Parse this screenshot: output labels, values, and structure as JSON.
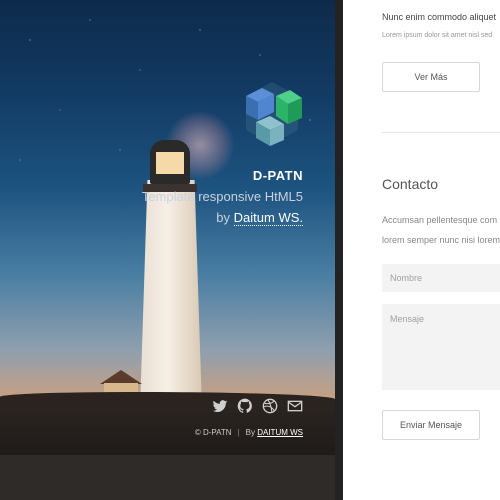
{
  "hero": {
    "brand_name": "D-PATN",
    "tagline": "Template responsive HtML5",
    "by_prefix": "by",
    "by_link": "Daitum WS.",
    "social_icons": [
      "twitter-icon",
      "github-icon",
      "dribbble-icon",
      "mail-icon"
    ],
    "footer_copyright": "© D-PATN",
    "footer_separator": "|",
    "footer_by_prefix": "By",
    "footer_by_link": "DAITUM WS"
  },
  "content": {
    "top_title": "Nunc enim commodo aliquet",
    "top_subtitle": "Lorem ipsum dolor sit amet nisl sed",
    "more_button": "Ver Más",
    "contact_title": "Contacto",
    "contact_text_line1": "Accumsan pellentesque com",
    "contact_text_line2": "lorem semper nunc nisi lorem",
    "name_placeholder": "Nombre",
    "message_placeholder": "Mensaje",
    "send_button": "Enviar Mensaje"
  },
  "colors": {
    "sky_top": "#0e2a4a",
    "sunset": "#c8a083",
    "logo_blue": "#3a6fb0",
    "logo_green": "#2bb36a",
    "logo_teal": "#5a9aa8"
  }
}
